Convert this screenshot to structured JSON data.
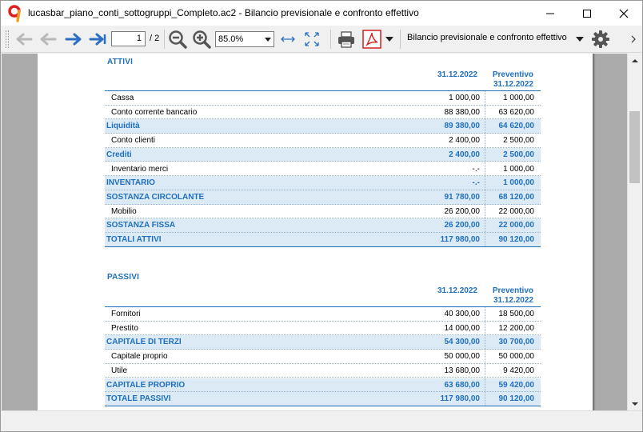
{
  "window": {
    "title": "lucasbar_piano_conti_sottogruppi_Completo.ac2 - Bilancio previsionale e confronto effettivo",
    "logo_glyph": "9"
  },
  "toolbar": {
    "page_current": "1",
    "page_total": "/ 2",
    "zoom": "85.0%",
    "report_name": "Bilancio previsionale e confronto effettivo",
    "icons": [
      "back-icon",
      "forward-disabled-icon",
      "next-page-icon",
      "last-page-icon",
      "zoom-out-icon",
      "zoom-in-icon",
      "fit-width-icon",
      "fit-page-icon",
      "print-icon",
      "pdf-icon",
      "settings-icon"
    ]
  },
  "colors": {
    "accent": "#1f6fbf",
    "subtotal_bg": "#dceaf6",
    "viewport_bg": "#ababab"
  },
  "attivi": {
    "title": "ATTIVI",
    "col1": "31.12.2022",
    "col2a": "Preventivo",
    "col2b": "31.12.2022",
    "rows": [
      {
        "label": "Cassa",
        "v1": "1 000,00",
        "v2": "1 000,00",
        "type": "item"
      },
      {
        "label": "Conto corrente bancario",
        "v1": "88 380,00",
        "v2": "63 620,00",
        "type": "item"
      },
      {
        "label": "Liquidità",
        "v1": "89 380,00",
        "v2": "64 620,00",
        "type": "sub"
      },
      {
        "label": "Conto clienti",
        "v1": "2 400,00",
        "v2": "2 500,00",
        "type": "item"
      },
      {
        "label": "Crediti",
        "v1": "2 400,00",
        "v2": "2 500,00",
        "type": "sub"
      },
      {
        "label": "Inventario merci",
        "v1": "-.-",
        "v2": "1 000,00",
        "type": "item"
      },
      {
        "label": "INVENTARIO",
        "v1": "-.-",
        "v2": "1 000,00",
        "type": "sub"
      },
      {
        "label": "SOSTANZA CIRCOLANTE",
        "v1": "91 780,00",
        "v2": "68 120,00",
        "type": "sub"
      },
      {
        "label": "Mobilio",
        "v1": "26 200,00",
        "v2": "22 000,00",
        "type": "item"
      },
      {
        "label": "SOSTANZA FISSA",
        "v1": "26 200,00",
        "v2": "22 000,00",
        "type": "sub"
      },
      {
        "label": "TOTALI ATTIVI",
        "v1": "117 980,00",
        "v2": "90 120,00",
        "type": "sub"
      }
    ]
  },
  "passivi": {
    "title": "PASSIVI",
    "col1": "31.12.2022",
    "col2a": "Preventivo",
    "col2b": "31.12.2022",
    "rows": [
      {
        "label": "Fornitori",
        "v1": "40 300,00",
        "v2": "18 500,00",
        "type": "item"
      },
      {
        "label": "Prestito",
        "v1": "14 000,00",
        "v2": "12 200,00",
        "type": "item"
      },
      {
        "label": "CAPITALE DI TERZI",
        "v1": "54 300,00",
        "v2": "30 700,00",
        "type": "sub"
      },
      {
        "label": "Capitale proprio",
        "v1": "50 000,00",
        "v2": "50 000,00",
        "type": "item"
      },
      {
        "label": "Utile",
        "v1": "13 680,00",
        "v2": "9 420,00",
        "type": "item"
      },
      {
        "label": "CAPITALE PROPRIO",
        "v1": "63 680,00",
        "v2": "59 420,00",
        "type": "sub"
      },
      {
        "label": "TOTALE PASSIVI",
        "v1": "117 980,00",
        "v2": "90 120,00",
        "type": "sub"
      }
    ]
  }
}
